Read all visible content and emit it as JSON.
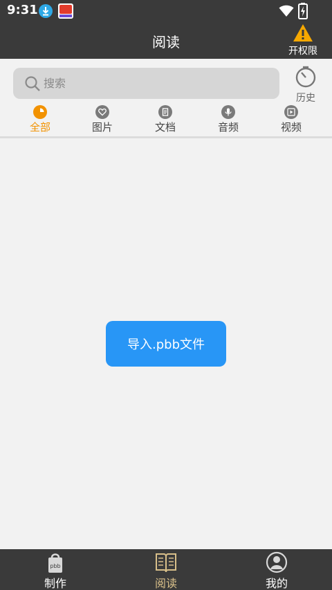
{
  "status_bar": {
    "time": "9:31"
  },
  "header": {
    "title": "阅读",
    "permission_label": "开权限"
  },
  "search": {
    "placeholder": "搜索",
    "value": "",
    "history_label": "历史"
  },
  "tabs": [
    {
      "label": "全部",
      "icon": "pie-icon",
      "active": true
    },
    {
      "label": "图片",
      "icon": "heart-icon",
      "active": false
    },
    {
      "label": "文档",
      "icon": "document-icon",
      "active": false
    },
    {
      "label": "音频",
      "icon": "mic-icon",
      "active": false
    },
    {
      "label": "视频",
      "icon": "video-icon",
      "active": false
    }
  ],
  "main": {
    "import_button_label": "导入.pbb文件"
  },
  "bottom_nav": [
    {
      "label": "制作",
      "icon": "pbb-bag-icon",
      "active": false
    },
    {
      "label": "阅读",
      "icon": "book-icon",
      "active": true
    },
    {
      "label": "我的",
      "icon": "user-icon",
      "active": false
    }
  ],
  "colors": {
    "accent": "#f29200",
    "primary_button": "#2896f6",
    "bar_bg": "#3a3a3a",
    "nav_active": "#d9c08a"
  }
}
